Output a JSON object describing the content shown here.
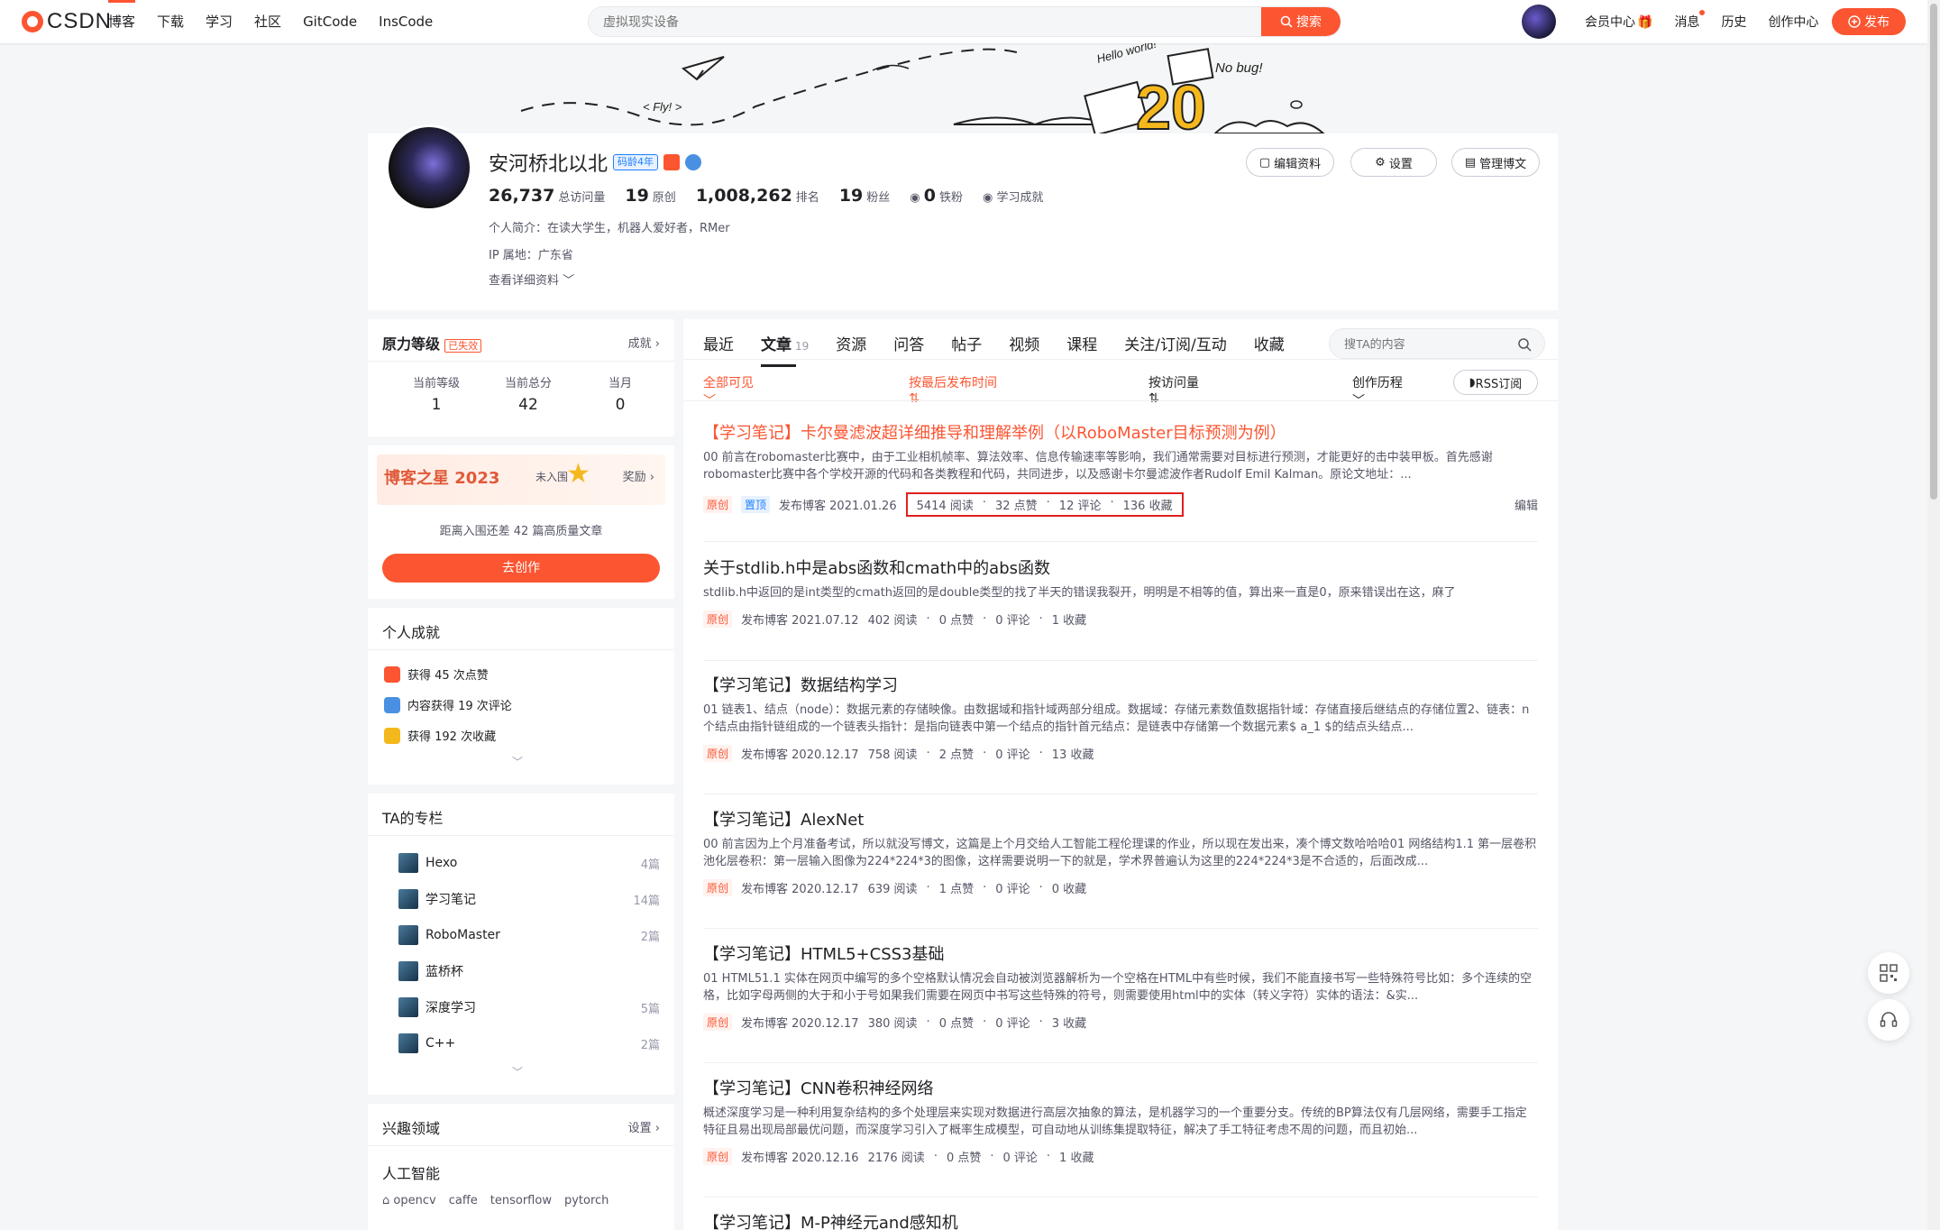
{
  "header": {
    "logo_text": "CSDN",
    "nav": [
      "博客",
      "下载",
      "学习",
      "社区",
      "GitCode",
      "InsCode"
    ],
    "search_placeholder": "虚拟现实设备",
    "search_button": "搜索",
    "right_nav": [
      "会员中心",
      "消息",
      "历史",
      "创作中心"
    ],
    "publish_button": "发布"
  },
  "banner": {
    "text_fly": "< Fly! >",
    "text_hello": "Hello world!",
    "text_nobug": "No bug!",
    "number": "20"
  },
  "profile": {
    "name": "安河桥北以北",
    "code_age": "码龄4年",
    "stats": [
      {
        "value": "26,737",
        "label": "总访问量"
      },
      {
        "value": "19",
        "label": "原创"
      },
      {
        "value": "1,008,262",
        "label": "排名"
      },
      {
        "value": "19",
        "label": "粉丝"
      },
      {
        "value": "0",
        "label": "铁粉"
      },
      {
        "value": "",
        "label": "学习成就"
      }
    ],
    "intro": "个人简介：在读大学生，机器人爱好者，RMer",
    "ip": "IP 属地：广东省",
    "more": "查看详细资料",
    "buttons": [
      "编辑资料",
      "设置",
      "管理博文"
    ]
  },
  "level": {
    "title": "原力等级",
    "badge": "已失效",
    "link": "成就",
    "cols": [
      {
        "label": "当前等级",
        "value": "1"
      },
      {
        "label": "当前总分",
        "value": "42"
      },
      {
        "label": "当月",
        "value": "0"
      }
    ]
  },
  "star": {
    "title": "博客之星 2023",
    "status": "未入围",
    "link": "奖励",
    "note": "距离入围还差 42 篇高质量文章",
    "button": "去创作"
  },
  "achievements": {
    "title": "个人成就",
    "items": [
      "获得 45 次点赞",
      "内容获得 19 次评论",
      "获得 192 次收藏"
    ]
  },
  "columns": {
    "title": "TA的专栏",
    "items": [
      {
        "name": "Hexo",
        "count": "4篇"
      },
      {
        "name": "学习笔记",
        "count": "14篇"
      },
      {
        "name": "RoboMaster",
        "count": "2篇"
      },
      {
        "name": "蓝桥杯",
        "count": ""
      },
      {
        "name": "深度学习",
        "count": "5篇"
      },
      {
        "name": "C++",
        "count": "2篇"
      }
    ]
  },
  "interests": {
    "title": "兴趣领域",
    "link": "设置",
    "field": "人工智能",
    "tags": [
      "opencv",
      "caffe",
      "tensorflow",
      "pytorch"
    ]
  },
  "main": {
    "tabs": [
      {
        "label": "最近",
        "count": ""
      },
      {
        "label": "文章",
        "count": "19"
      },
      {
        "label": "资源",
        "count": ""
      },
      {
        "label": "问答",
        "count": ""
      },
      {
        "label": "帖子",
        "count": ""
      },
      {
        "label": "视频",
        "count": ""
      },
      {
        "label": "课程",
        "count": ""
      },
      {
        "label": "关注/订阅/互动",
        "count": ""
      },
      {
        "label": "收藏",
        "count": ""
      }
    ],
    "search_placeholder": "搜TA的内容",
    "filters": [
      "全部可见",
      "按最后发布时间",
      "按访问量",
      "创作历程"
    ],
    "rss": "RSS订阅",
    "edit": "编辑",
    "articles": [
      {
        "title": "【学习笔记】卡尔曼滤波超详细推导和理解举例（以RoboMaster目标预测为例）",
        "desc": "00 前言在robomaster比赛中，由于工业相机帧率、算法效率、信息传输速率等影响，我们通常需要对目标进行预测，才能更好的击中装甲板。首先感谢robomaster比赛中各个学校开源的代码和各类教程和代码，共同进步，以及感谢卡尔曼滤波作者Rudolf Emil Kalman。原论文地址：...",
        "orig": "原创",
        "top": "置顶",
        "date": "发布博客 2021.01.26",
        "stats": [
          "5414 阅读",
          "32 点赞",
          "12 评论",
          "136 收藏"
        ]
      },
      {
        "title": "关于stdlib.h中是abs函数和cmath中的abs函数",
        "desc": "stdlib.h中返回的是int类型的cmath返回的是double类型的找了半天的错误我裂开，明明是不相等的值，算出来一直是0，原来错误出在这，麻了",
        "orig": "原创",
        "top": "",
        "date": "发布博客 2021.07.12",
        "stats": [
          "402 阅读",
          "0 点赞",
          "0 评论",
          "1 收藏"
        ]
      },
      {
        "title": "【学习笔记】数据结构学习",
        "desc": "01 链表1、结点（node）：数据元素的存储映像。由数据域和指针域两部分组成。数据域：存储元素数值数据指针域：存储直接后继结点的存储位置2、链表：n个结点由指针链组成的一个链表头指针：是指向链表中第一个结点的指针首元结点：是链表中存储第一个数据元素$ a_1 $的结点头结点...",
        "orig": "原创",
        "top": "",
        "date": "发布博客 2020.12.17",
        "stats": [
          "758 阅读",
          "2 点赞",
          "0 评论",
          "13 收藏"
        ]
      },
      {
        "title": "【学习笔记】AlexNet",
        "desc": "00 前言因为上个月准备考试，所以就没写博文，这篇是上个月交给人工智能工程伦理课的作业，所以现在发出来，凑个博文数哈哈哈01 网络结构1.1 第一层卷积池化层卷积：第一层输入图像为224*224*3的图像，这样需要说明一下的就是，学术界普遍认为这里的224*224*3是不合适的，后面改成...",
        "orig": "原创",
        "top": "",
        "date": "发布博客 2020.12.17",
        "stats": [
          "639 阅读",
          "1 点赞",
          "0 评论",
          "0 收藏"
        ]
      },
      {
        "title": "【学习笔记】HTML5+CSS3基础",
        "desc": "01 HTML51.1 实体在网页中编写的多个空格默认情况会自动被浏览器解析为一个空格在HTML中有些时候，我们不能直接书写一些特殊符号比如：多个连续的空格，比如字母两侧的大于和小于号如果我们需要在网页中书写这些特殊的符号，则需要使用html中的实体（转义字符）实体的语法：&实...",
        "orig": "原创",
        "top": "",
        "date": "发布博客 2020.12.17",
        "stats": [
          "380 阅读",
          "0 点赞",
          "0 评论",
          "3 收藏"
        ]
      },
      {
        "title": "【学习笔记】CNN卷积神经网络",
        "desc": "概述深度学习是一种利用复杂结构的多个处理层来实现对数据进行高层次抽象的算法，是机器学习的一个重要分支。传统的BP算法仅有几层网络，需要手工指定特征且易出现局部最优问题，而深度学习引入了概率生成模型，可自动地从训练集提取特征，解决了手工特征考虑不周的问题，而且初始...",
        "orig": "原创",
        "top": "",
        "date": "发布博客 2020.12.16",
        "stats": [
          "2176 阅读",
          "0 点赞",
          "0 评论",
          "1 收藏"
        ]
      },
      {
        "title": "【学习笔记】M-P神经元and感知机",
        "desc": "",
        "orig": "",
        "top": "",
        "date": "",
        "stats": []
      }
    ]
  },
  "colors": {
    "accent": "#fc5531",
    "blue": "#1e80ff",
    "highlight_box": "#e02020"
  }
}
